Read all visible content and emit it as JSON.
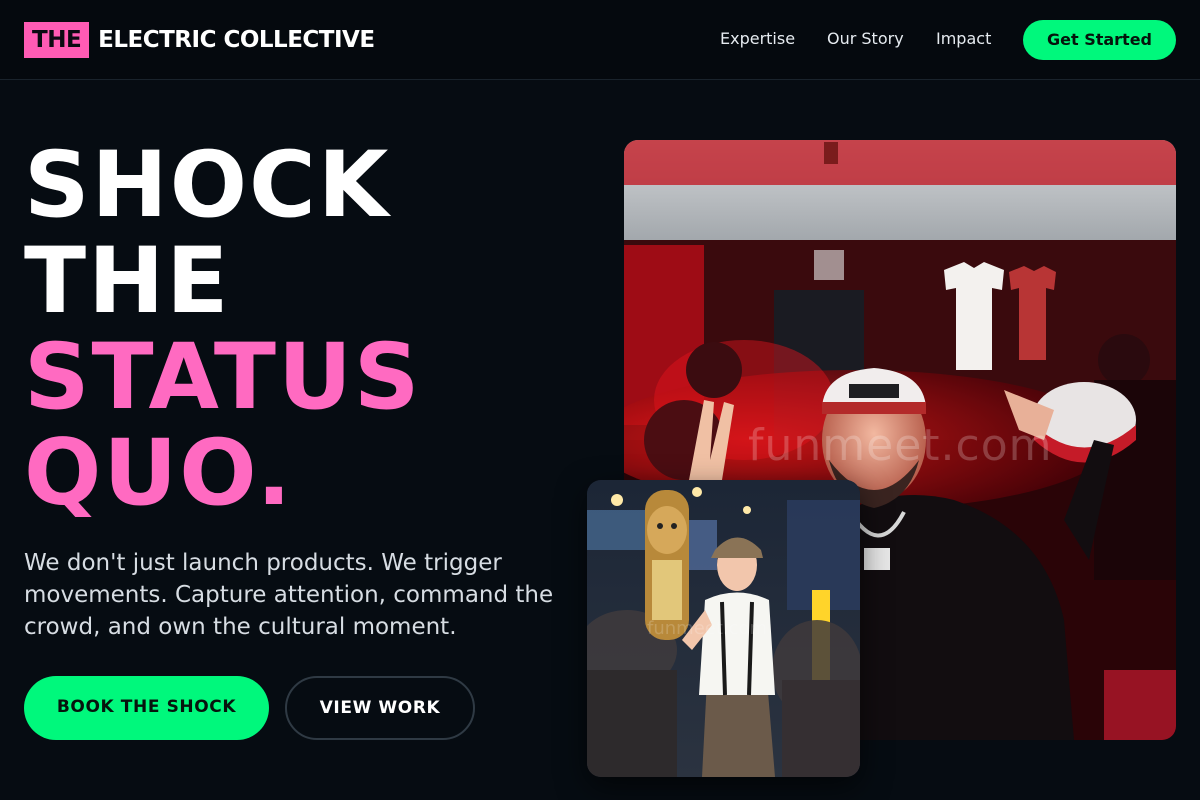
{
  "brand": {
    "logo_box": "THE",
    "logo_text": "ELECTRIC COLLECTIVE"
  },
  "nav": {
    "links": [
      "Expertise",
      "Our Story",
      "Impact"
    ],
    "cta": "Get Started"
  },
  "hero": {
    "headline": [
      "SHOCK",
      "THE",
      "STATUS",
      "QUO."
    ],
    "subcopy": "We don't just launch products. We trigger movements. Capture attention, command the crowd, and own the cultural moment.",
    "primary_button": "BOOK THE SHOCK",
    "secondary_button": "VIEW WORK"
  },
  "photos": {
    "main_watermark": "funmeet.com",
    "secondary_watermark": "funmeet.com"
  },
  "colors": {
    "background": "#060c12",
    "accent_green": "#00f87c",
    "accent_pink": "#ff6ac1"
  }
}
